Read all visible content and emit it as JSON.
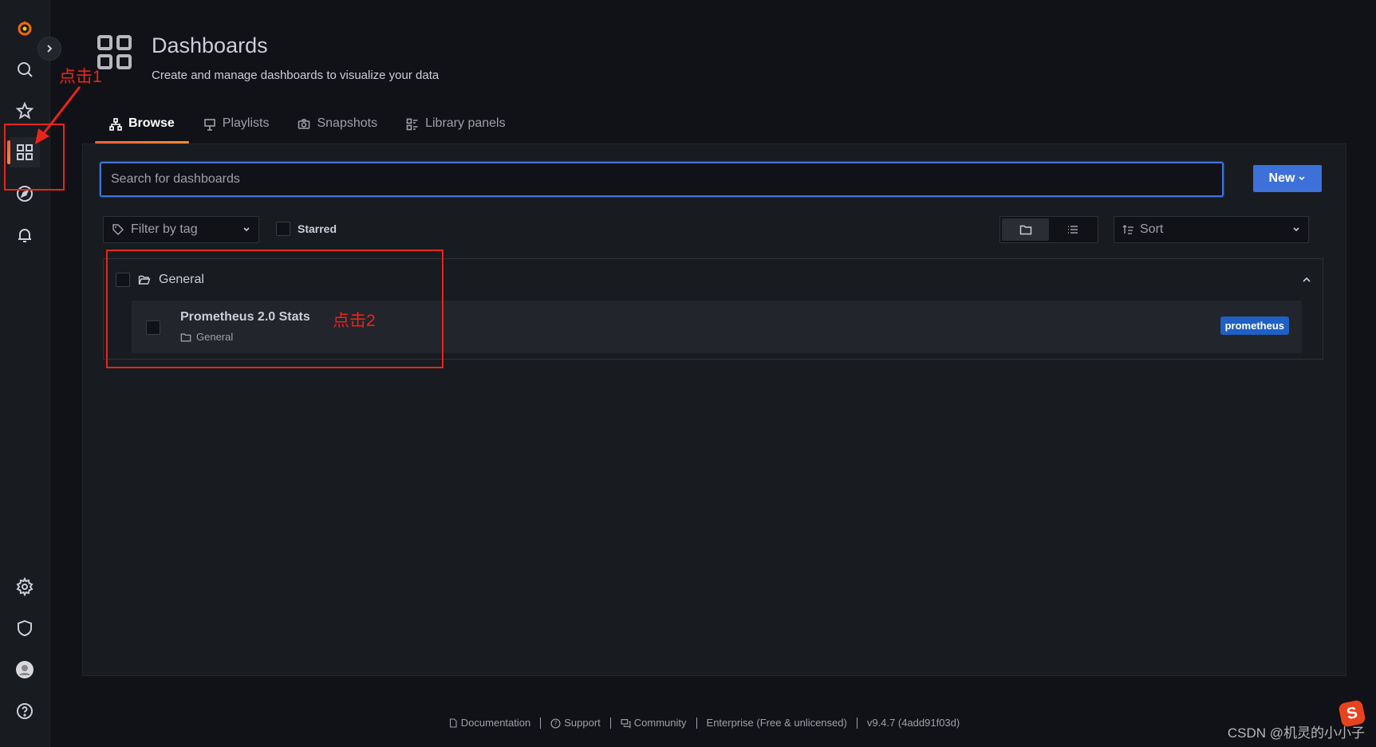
{
  "header": {
    "title": "Dashboards",
    "subtitle": "Create and manage dashboards to visualize your data"
  },
  "tabs": [
    {
      "label": "Browse",
      "icon": "sitemap-icon",
      "active": true
    },
    {
      "label": "Playlists",
      "icon": "presentation-icon"
    },
    {
      "label": "Snapshots",
      "icon": "camera-icon"
    },
    {
      "label": "Library panels",
      "icon": "library-panel-icon"
    }
  ],
  "search": {
    "placeholder": "Search for dashboards",
    "value": ""
  },
  "new_button": {
    "label": "New"
  },
  "filters": {
    "tag_placeholder": "Filter by tag",
    "starred_label": "Starred",
    "sort_placeholder": "Sort"
  },
  "folder": {
    "name": "General",
    "dashboards": [
      {
        "title": "Prometheus 2.0 Stats",
        "folder": "General",
        "tags": [
          "prometheus"
        ]
      }
    ]
  },
  "annotations": {
    "step1": "点击1",
    "step2": "点击2"
  },
  "footer": {
    "documentation": "Documentation",
    "support": "Support",
    "community": "Community",
    "edition": "Enterprise (Free & unlicensed)",
    "version": "v9.4.7 (4add91f03d)"
  },
  "watermark": "CSDN @机灵的小小子",
  "colors": {
    "accent_blue": "#3d71d9",
    "tag_blue": "#1f60c4",
    "annotation_red": "#e8251c",
    "tab_active_gradient": "#f55f3e"
  }
}
